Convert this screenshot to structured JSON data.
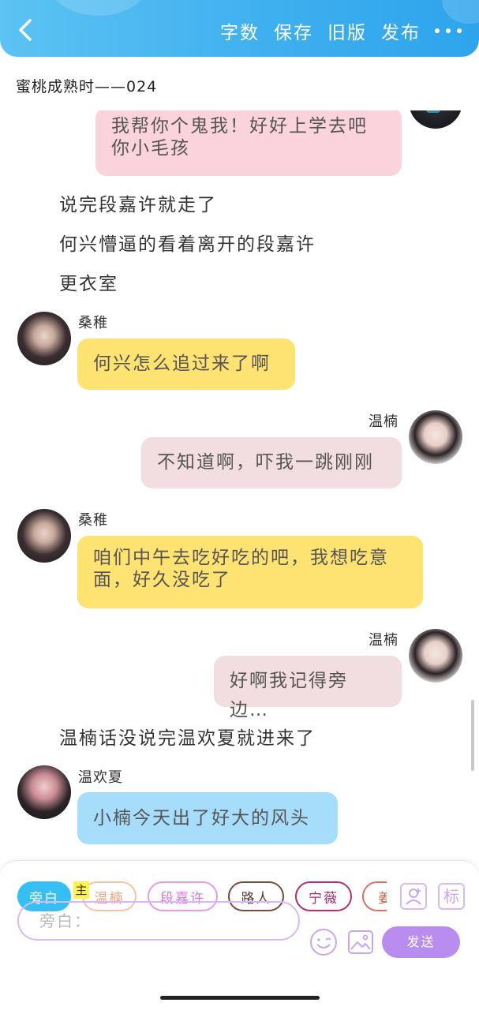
{
  "header": {
    "actions": [
      "字数",
      "保存",
      "旧版",
      "发布"
    ]
  },
  "doc_title": "蜜桃成熟时——024",
  "messages": {
    "top_bubble": "我帮你个鬼我！好好上学去吧你小毛孩",
    "narr1": "说完段嘉许就走了",
    "narr2": "何兴懵逼的看着离开的段嘉许",
    "narr3": "更衣室",
    "name_sangzhi_1": "桑稚",
    "msg_sangzhi_1": "何兴怎么追过来了啊",
    "name_wennan_1": "温楠",
    "msg_wennan_1": "不知道啊，吓我一跳刚刚",
    "name_sangzhi_2": "桑稚",
    "msg_sangzhi_2": "咱们中午去吃好吃的吧，我想吃意面，好久没吃了",
    "name_wennan_2": "温楠",
    "msg_wennan_2": "好啊我记得旁边…",
    "narr4": "温楠话没说完温欢夏就进来了",
    "name_wenhuanxia": "温欢夏",
    "msg_wenhuanxia": "小楠今天出了好大的风头"
  },
  "bottom": {
    "roles": [
      "旁白",
      "温楠",
      "段嘉许",
      "路人",
      "宁薇",
      "姜"
    ],
    "main_tag": "主",
    "label_icon_text": "标",
    "input_placeholder": "旁白：",
    "send_label": "发送"
  },
  "colors": {
    "header_blue": "#3fb0ef",
    "narrator_chip": "#35bff5",
    "send_purple": "#b98cf0"
  }
}
